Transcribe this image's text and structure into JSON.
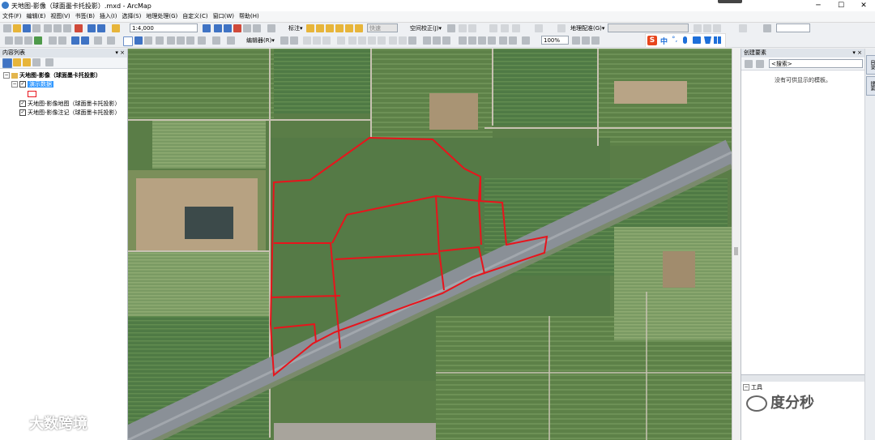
{
  "window": {
    "title": "天地图-影像（球面墨卡托投影）.mxd - ArcMap",
    "minimize": "─",
    "maximize": "☐",
    "close": "✕"
  },
  "menu": [
    "文件(F)",
    "编辑(E)",
    "视图(V)",
    "书签(B)",
    "插入(I)",
    "选择(S)",
    "地理处理(G)",
    "自定义(C)",
    "窗口(W)",
    "帮助(H)"
  ],
  "toolbar": {
    "scale_value": "1:4,000",
    "label_menu": "标注▾",
    "quick_value": "快速",
    "spatial_adjust": "空间校正(J)▾",
    "editor_menu": "编辑器(R)▾",
    "zoom_value": "100%",
    "georef_menu": "地理配准(G)▾"
  },
  "toc": {
    "header": "内容列表",
    "pin": "▾ ×",
    "dataframe": "天地图-影像（球面墨卡托投影）",
    "layers": [
      {
        "name": "演示数据",
        "checked": true,
        "selected": true
      },
      {
        "name": "天地图-影像地图（球面墨卡托投影）",
        "checked": true,
        "selected": false
      },
      {
        "name": "天地图-影像注记（球面墨卡托投影）",
        "checked": true,
        "selected": false
      }
    ]
  },
  "create_features": {
    "header": "创建要素",
    "pin": "▾ ×",
    "search_placeholder": "<搜索>",
    "empty_message": "没有可供显示的模板。",
    "tools_header": "工具"
  },
  "right_tabs": [
    "目录",
    "搜索"
  ],
  "watermarks": {
    "left": "大数跨境",
    "right": "度分秒"
  },
  "colors": {
    "accent": "#3399ff",
    "polygon_outline": "#e8141c",
    "highway": "#8a9097"
  }
}
